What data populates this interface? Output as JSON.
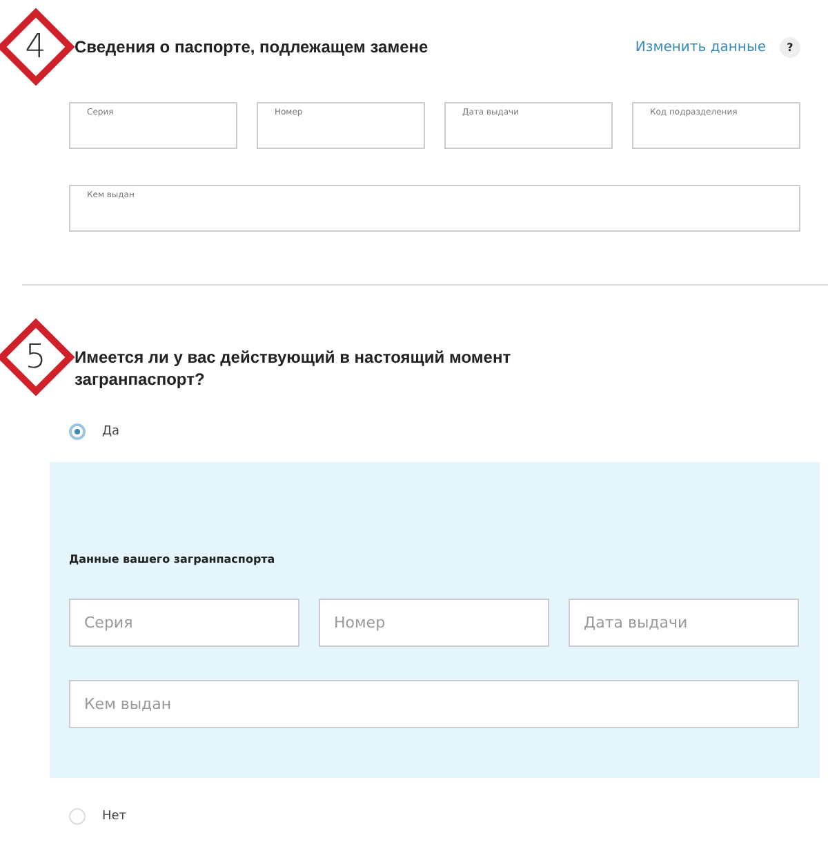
{
  "sections": [
    {
      "step": "4",
      "title": "Сведения о паспорте, подлежащем замене",
      "link": "Изменить данные",
      "help": "?",
      "fields": [
        {
          "label": "Серия",
          "wide": false
        },
        {
          "label": "Номер",
          "wide": false
        },
        {
          "label": "Дата выдачи",
          "wide": false
        },
        {
          "label": "Код подразделения",
          "wide": false
        },
        {
          "label": "Кем выдан",
          "wide": true
        }
      ]
    },
    {
      "step": "5",
      "title": "Имеется ли у вас действующий в настоящий момент загранпаспорт?",
      "options": [
        {
          "label": "Да",
          "selected": true,
          "panel": {
            "title": "Данные вашего загранпаспорта",
            "fields": [
              {
                "placeholder": "Серия",
                "wide": false
              },
              {
                "placeholder": "Номер",
                "wide": false
              },
              {
                "placeholder": "Дата выдачи",
                "wide": false
              },
              {
                "placeholder": "Кем выдан",
                "wide": true
              }
            ]
          }
        },
        {
          "label": "Нет",
          "selected": false
        }
      ]
    }
  ]
}
